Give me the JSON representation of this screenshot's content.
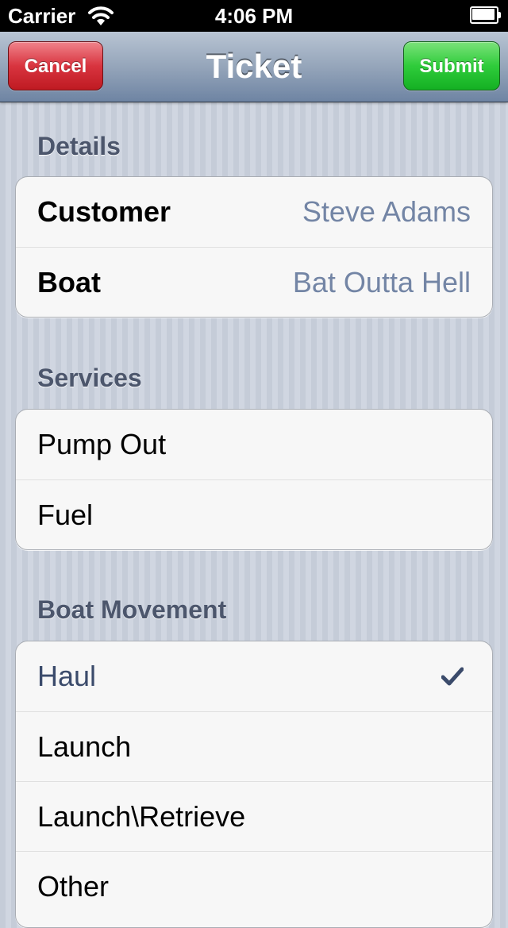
{
  "status_bar": {
    "carrier": "Carrier",
    "time": "4:06 PM",
    "icons": [
      "wifi-icon",
      "battery-icon"
    ]
  },
  "nav": {
    "title": "Ticket",
    "cancel_label": "Cancel",
    "submit_label": "Submit"
  },
  "sections": {
    "details": {
      "header": "Details",
      "rows": [
        {
          "label": "Customer",
          "value": "Steve Adams"
        },
        {
          "label": "Boat",
          "value": "Bat Outta Hell"
        }
      ]
    },
    "services": {
      "header": "Services",
      "rows": [
        {
          "label": "Pump Out"
        },
        {
          "label": "Fuel"
        }
      ]
    },
    "boat_movement": {
      "header": "Boat Movement",
      "rows": [
        {
          "label": "Haul",
          "selected": true
        },
        {
          "label": "Launch"
        },
        {
          "label": "Launch\\Retrieve"
        },
        {
          "label": "Other"
        }
      ]
    }
  },
  "colors": {
    "cancel": "#d8343f",
    "submit": "#2fcc3b",
    "nav_bar": "#95a5ba",
    "detail_value": "#7385a5",
    "selected_text": "#3b4b6b"
  }
}
